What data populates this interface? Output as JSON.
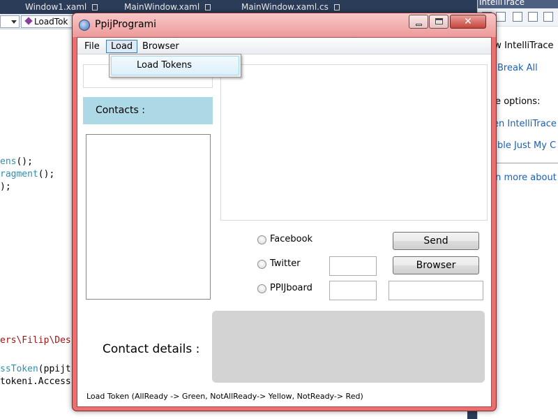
{
  "ide": {
    "tabs": [
      "Window1.xaml",
      "MainWindow.xaml",
      "MainWindow.xaml.cs"
    ],
    "member_dropdown": "LoadTok",
    "code_lines": [
      {
        "plain": "",
        "colored": "ens",
        "suffix": "();",
        "color": "teal"
      },
      {
        "plain": "",
        "colored": "ragment",
        "suffix": "();",
        "color": "teal"
      },
      {
        "plain": ");",
        "colored": "",
        "suffix": "",
        "color": "none"
      },
      {
        "plain": "",
        "colored": "ers\\Filip\\Des",
        "suffix": "",
        "color": "red"
      },
      {
        "plain": "",
        "colored": "ssToken",
        "suffix": "(ppijt",
        "color": "teal"
      },
      {
        "plain": "tokeni.Access",
        "colored": "",
        "suffix": "",
        "color": "none"
      }
    ],
    "panel": {
      "title": "IntelliTrace",
      "line1": "view IntelliTrace",
      "link_break": "Break All",
      "options": "re options:",
      "link_open": "en IntelliTrace",
      "link_enable": "able Just My C",
      "link_learn": "rn more about"
    }
  },
  "app": {
    "title": "PpijProgrami",
    "close_glyph": "✕",
    "menu": {
      "file": "File",
      "load": "Load",
      "browser": "Browser"
    },
    "load_menu_items": [
      "Load Tokens"
    ],
    "contacts_header": "Contacts :",
    "radios": {
      "facebook": "Facebook",
      "twitter": "Twitter",
      "ppij": "PPIJboard"
    },
    "buttons": {
      "send": "Send",
      "browser": "Browser"
    },
    "contact_details_label": "Contact details :",
    "status_text": "Load Token (AllReady -> Green, NotAllReady-> Yellow, NotReady-> Red)"
  },
  "colors": {
    "window_frame": "#ed6e6e",
    "contacts_header_bg": "#add8e6",
    "details_panel_bg": "#d3d3d3",
    "menu_highlight": "#3c7fb1"
  }
}
